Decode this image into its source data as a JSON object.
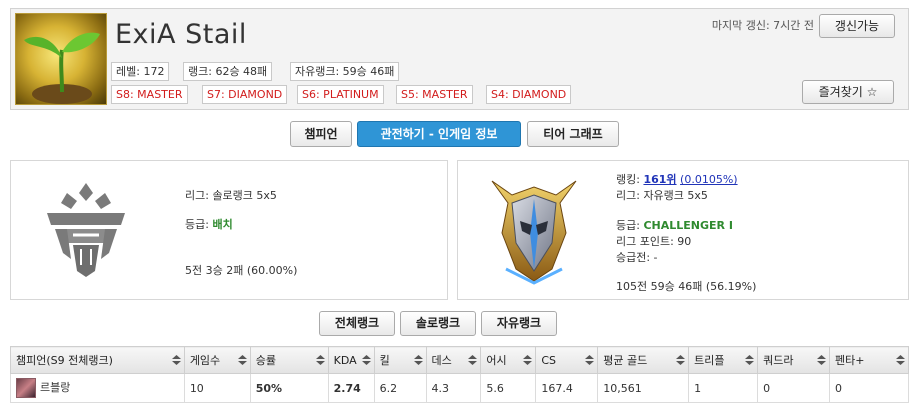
{
  "summoner": {
    "name": "ExiA Stail",
    "level": "레벨: 172",
    "solo_rank": "랭크: 62승 48패",
    "flex_rank": "자유랭크: 59승 46패",
    "seasons": [
      "S8: MASTER",
      "S7: DIAMOND",
      "S6: PLATINUM",
      "S5: MASTER",
      "S4: DIAMOND"
    ],
    "last_update": "마지막 갱신: 7시간 전",
    "refresh_label": "갱신가능",
    "favorite_label": "즐겨찾기 ☆"
  },
  "tabs": [
    "챔피언",
    "관전하기 - 인게임 정보",
    "티어 그래프"
  ],
  "solo_panel": {
    "league": "리그: 솔로랭크 5x5",
    "tier_label": "등급: ",
    "tier_value": "배치",
    "record": "5전 3승 2패 (60.00%)"
  },
  "flex_panel": {
    "ranking_label": "랭킹: ",
    "ranking_value": "161위",
    "ranking_pct": "(0.0105%)",
    "league": "리그: 자유랭크 5x5",
    "tier_label": "등급: ",
    "tier_value": "CHALLENGER I",
    "league_points": "리그 포인트: 90",
    "promo": "승급전: -",
    "record": "105전 59승 46패 (56.19%)"
  },
  "rank_tabs": [
    "전체랭크",
    "솔로랭크",
    "자유랭크"
  ],
  "table": {
    "headers": [
      "챔피언(S9 전체랭크)",
      "게임수",
      "승률",
      "KDA",
      "킬",
      "데스",
      "어시",
      "CS",
      "평균 골드",
      "트리플",
      "쿼드라",
      "펜타+"
    ],
    "rows": [
      [
        "르블랑",
        "10",
        "50%",
        "2.74",
        "6.2",
        "4.3",
        "5.6",
        "167.4",
        "10,561",
        "1",
        "0",
        "0"
      ]
    ]
  },
  "colors": {
    "accent": "#2f95d6",
    "season_red": "#d21c1c",
    "tier_green": "#2f8a2f",
    "link_blue": "#2034b8"
  }
}
